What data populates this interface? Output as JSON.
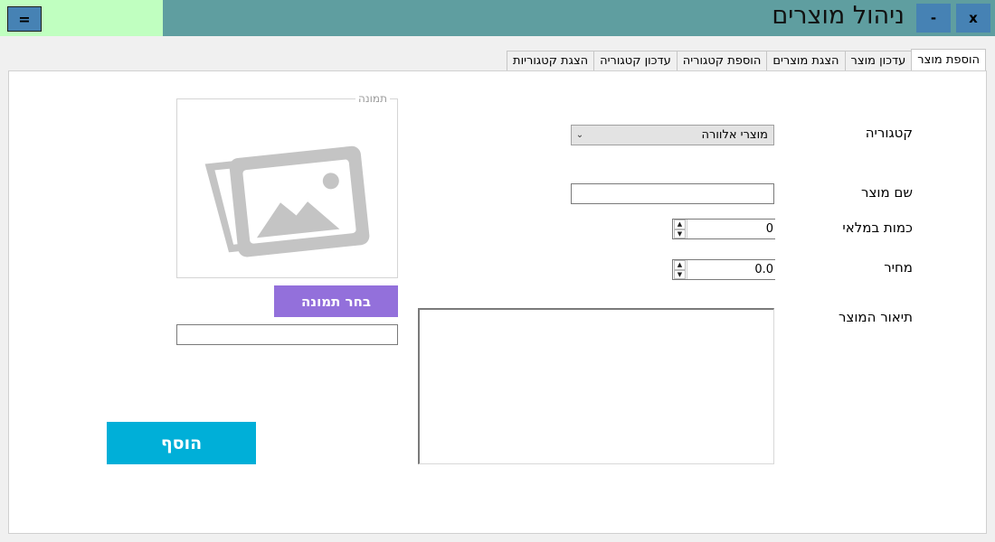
{
  "window": {
    "title": "ניהול מוצרים",
    "menu_label": "=",
    "minimize_label": "-",
    "close_label": "x"
  },
  "tabs": [
    {
      "label": "הוספת מוצר",
      "active": true
    },
    {
      "label": "עדכון מוצר",
      "active": false
    },
    {
      "label": "הצגת מוצרים",
      "active": false
    },
    {
      "label": "הוספת קטגוריה",
      "active": false
    },
    {
      "label": "עדכון קטגוריה",
      "active": false
    },
    {
      "label": "הצגת קטגוריות",
      "active": false
    }
  ],
  "form": {
    "category_label": "קטגוריה",
    "category_value": "מוצרי אלוורה",
    "name_label": "שם מוצר",
    "name_value": "",
    "quantity_label": "כמות במלאי",
    "quantity_value": "0",
    "price_label": "מחיר",
    "price_value": "0.0",
    "description_label": "תיאור המוצר",
    "description_value": ""
  },
  "image_group": {
    "title": "תמונה",
    "choose_button": "בחר תמונה",
    "path_value": ""
  },
  "add_button": "הוסף",
  "colors": {
    "titlebar": "#5f9ea0",
    "titlebar_left": "#c0ffc0",
    "window_buttons": "#4682b4",
    "choose_button": "#9370db",
    "add_button": "#00afd8"
  }
}
